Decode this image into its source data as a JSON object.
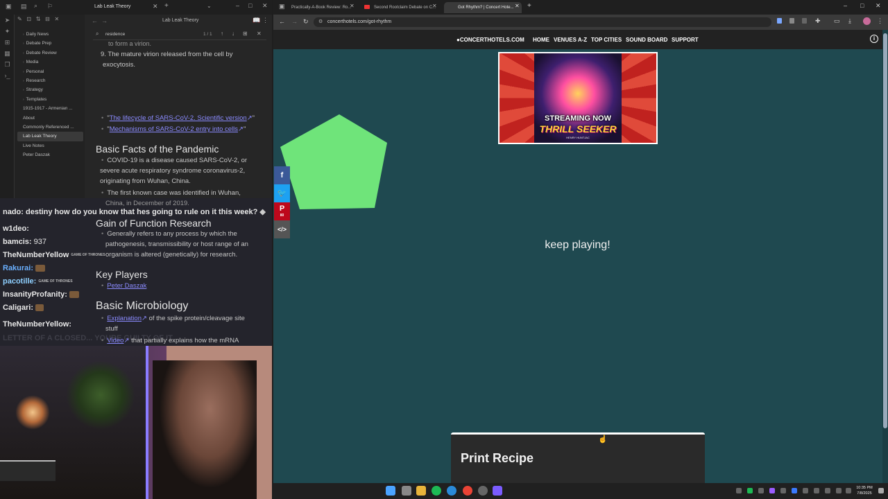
{
  "obsidian": {
    "tab_title": "Lab Leak Theory",
    "header_title": "Lab Leak Theory",
    "search_value": "residence",
    "search_count": "1 / 1",
    "folders": [
      "Daily News",
      "Debate Prep",
      "Debate Review",
      "Media",
      "Personal",
      "Research",
      "Strategy",
      "Templates"
    ],
    "files": [
      "1915-1917 - Armenian ...",
      "About",
      "Commonly Referenced ...",
      "Lab Leak Theory",
      "Live Notes",
      "Peter Daszak"
    ],
    "cut_line": "to form a virion.",
    "item9": "9.  The mature virion released from the cell by",
    "item9b": "exocytosis.",
    "link1": "The lifecycle of SARS-CoV-2. Scientific version",
    "link2": "Mechanisms of SARS-CoV-2 entry into cells",
    "h_basic_facts": "Basic Facts of the Pandemic",
    "bf1a": "COVID-19 is a disease caused SARS-CoV-2, or",
    "bf1b": "severe acute respiratory syndrome coronavirus-2,",
    "bf1c": "originating from Wuhan, China.",
    "bf2a": "The first known case was identified in Wuhan,",
    "bf2b": "China, in December of 2019.",
    "h_gof": "Gain of Function Research",
    "gof1": "Generally refers to any process by which the",
    "gof2": "pathogenesis, transmissibility or host range of an",
    "gof3": "organism is altered (genetically) for research.",
    "h_key": "Key Players",
    "key1": "Peter Daszak",
    "h_micro": "Basic Microbiology",
    "m1_link": "Explanation",
    "m1_rest": "of the spike protein/cleavage site",
    "m1_b": "stuff",
    "m2_link": "Video",
    "m2_rest": "that partially explains how the mRNA"
  },
  "chat": {
    "m1": "nado: destiny how do you know that hes going to rule on it this week?",
    "m2_user": "w1deo:",
    "m3_user": "bamcis:",
    "m3_text": "937",
    "m4_user": "TheNumberYellow",
    "m5_user": "Rakurai",
    "m6_user": "pacotille:",
    "m7_user": "InsanityProfanity:",
    "m8_user": "Caligari:",
    "m9_user": "TheNumberYellow:",
    "m10_faded": "LETTER OF A CLOSED... YOURE GUILTY OF IT",
    "got_emote": "GAME OF THRONES",
    "colors": {
      "rakurai": "#6ab0ff",
      "pacotille": "#8fd0ff",
      "default": "#e8e8e8"
    }
  },
  "browser": {
    "tabs": [
      "Practically-A-Book Review: Ro...",
      "Second Rootclaim Debate on C...",
      "Got Rhythm? | Concert Hote..."
    ],
    "url": "concerthotels.com/got-rhythm",
    "nav": {
      "logo": "CONCERTHOTELS.COM",
      "items": [
        "HOME",
        "VENUES A-Z",
        "TOP CITIES",
        "SOUND BOARD",
        "SUPPORT"
      ]
    },
    "ad": {
      "line1": "STREAMING NOW",
      "line2": "THRILL SEEKER",
      "line3": "HENRY HUNTJAC"
    },
    "share": {
      "pinterest_count": "80"
    },
    "keep_playing": "keep playing!",
    "print_recipe": "Print Recipe"
  },
  "taskbar": {
    "time": "10:35 PM",
    "date": "7/8/2025"
  },
  "colors": {
    "page_bg": "#1f4950",
    "pentagon": "#6fe47a"
  }
}
